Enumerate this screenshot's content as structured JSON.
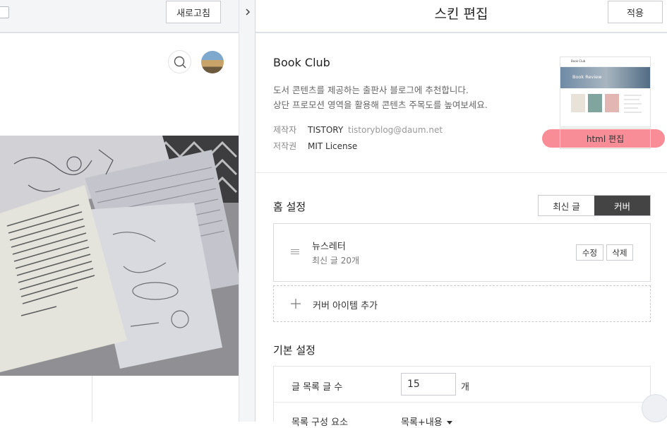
{
  "preview": {
    "refresh_label": "새로고침",
    "collapse_icon": "chevron-right-icon",
    "search_icon": "search-icon"
  },
  "header": {
    "title": "스킨 편집",
    "apply_label": "적용"
  },
  "skin": {
    "name": "Book Club",
    "description_line1": "도서 콘텐츠를 제공하는 출판사 블로그에 추천합니다.",
    "description_line2": "상단 프로모션 영역을 활용해 콘텐츠 주목도를 높여보세요.",
    "maker_label": "제작자",
    "maker_name": "TISTORY",
    "maker_email": "tistoryblog@daum.net",
    "copyright_label": "저작권",
    "copyright_value": "MIT License",
    "thumbnail_logo": "Book Club",
    "thumbnail_hero_text": "Book Review",
    "html_edit_label": "html 편집"
  },
  "home_settings": {
    "title": "홈 설정",
    "options": [
      "최신 글",
      "커버"
    ],
    "selected": "커버",
    "cover_item": {
      "name": "뉴스레터",
      "subtitle": "최신 글 20개",
      "edit_label": "수정",
      "delete_label": "삭제"
    },
    "add_cover_label": "커버 아이템 추가"
  },
  "basic_settings": {
    "title": "기본 설정",
    "post_count_label": "글 목록 글 수",
    "post_count_value": "15",
    "post_count_unit": "개",
    "list_composition_label": "목록 구성 요소",
    "list_composition_value": "목록+내용"
  },
  "colors": {
    "highlight": "#f4505f",
    "selected_segment": "#444444",
    "header_bg": "#f4f5f7"
  }
}
